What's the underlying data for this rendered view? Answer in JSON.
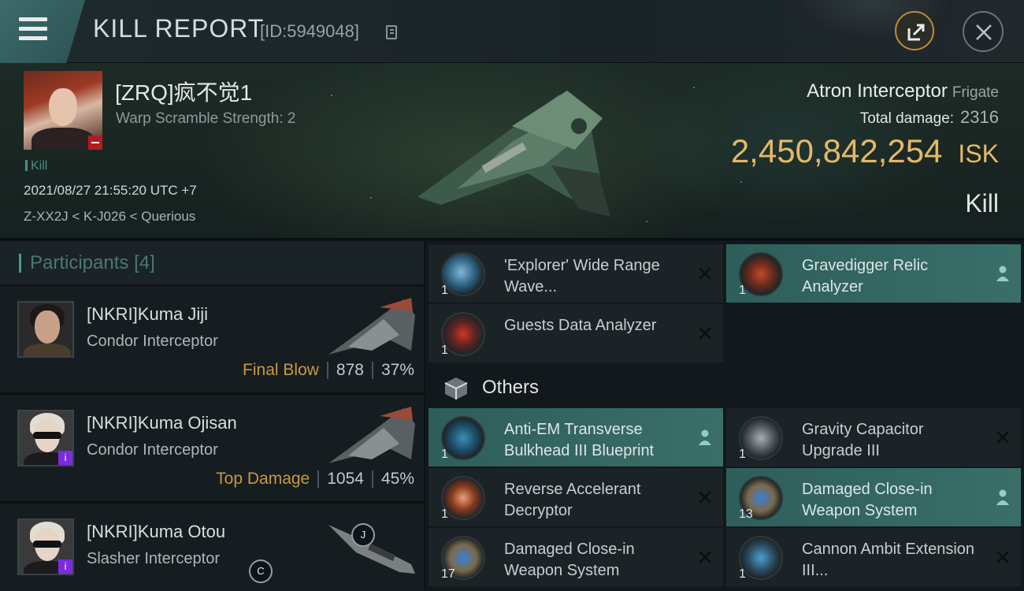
{
  "header": {
    "title": "KILL REPORT",
    "report_id": "[ID:5949048]"
  },
  "victim": {
    "name": "[ZRQ]疯不觉1",
    "warp_scramble": "Warp Scramble Strength: 2",
    "tag": "Kill",
    "datetime": "2021/08/27 21:55:20 UTC +7",
    "location": "Z-XX2J < K-J026 < Querious",
    "ship_name": "Atron Interceptor",
    "ship_class": "Frigate",
    "total_damage_label": "Total damage:",
    "total_damage": "2316",
    "isk_value": "2,450,842,254",
    "isk_unit": "ISK",
    "result": "Kill"
  },
  "participants": {
    "label": "Participants",
    "count": "[4]",
    "rows": [
      {
        "name": "[NKRI]Kuma Jiji",
        "ship": "Condor Interceptor",
        "role": "Final Blow",
        "damage": "878",
        "percent": "37%"
      },
      {
        "name": "[NKRI]Kuma Ojisan",
        "ship": "Condor Interceptor",
        "role": "Top Damage",
        "damage": "1054",
        "percent": "45%"
      },
      {
        "name": "[NKRI]Kuma Otou",
        "ship": "Slasher Interceptor"
      }
    ],
    "badges": {
      "i": "i",
      "j": "J",
      "c": "C"
    }
  },
  "items": {
    "section_others": "Others",
    "list": [
      {
        "name": "'Explorer' Wide Range Wave...",
        "qty": "1",
        "status": "destroyed"
      },
      {
        "name": "Gravedigger Relic Analyzer",
        "qty": "1",
        "status": "dropped"
      },
      {
        "name": "Guests Data Analyzer",
        "qty": "1",
        "status": "destroyed"
      },
      {
        "name": "Anti-EM Transverse Bulkhead III Blueprint",
        "qty": "1",
        "status": "dropped"
      },
      {
        "name": "Gravity Capacitor Upgrade III",
        "qty": "1",
        "status": "destroyed"
      },
      {
        "name": "Reverse Accelerant Decryptor",
        "qty": "1",
        "status": "destroyed"
      },
      {
        "name": "Damaged Close-in Weapon System",
        "qty": "13",
        "status": "dropped"
      },
      {
        "name": "Damaged Close-in Weapon System",
        "qty": "17",
        "status": "destroyed"
      },
      {
        "name": "Cannon Ambit Extension III...",
        "qty": "1",
        "status": "destroyed"
      }
    ]
  },
  "colors": {
    "accent_teal": "#3a6e69",
    "isk_gold": "#e6b866",
    "final_blow": "#c9993e"
  }
}
